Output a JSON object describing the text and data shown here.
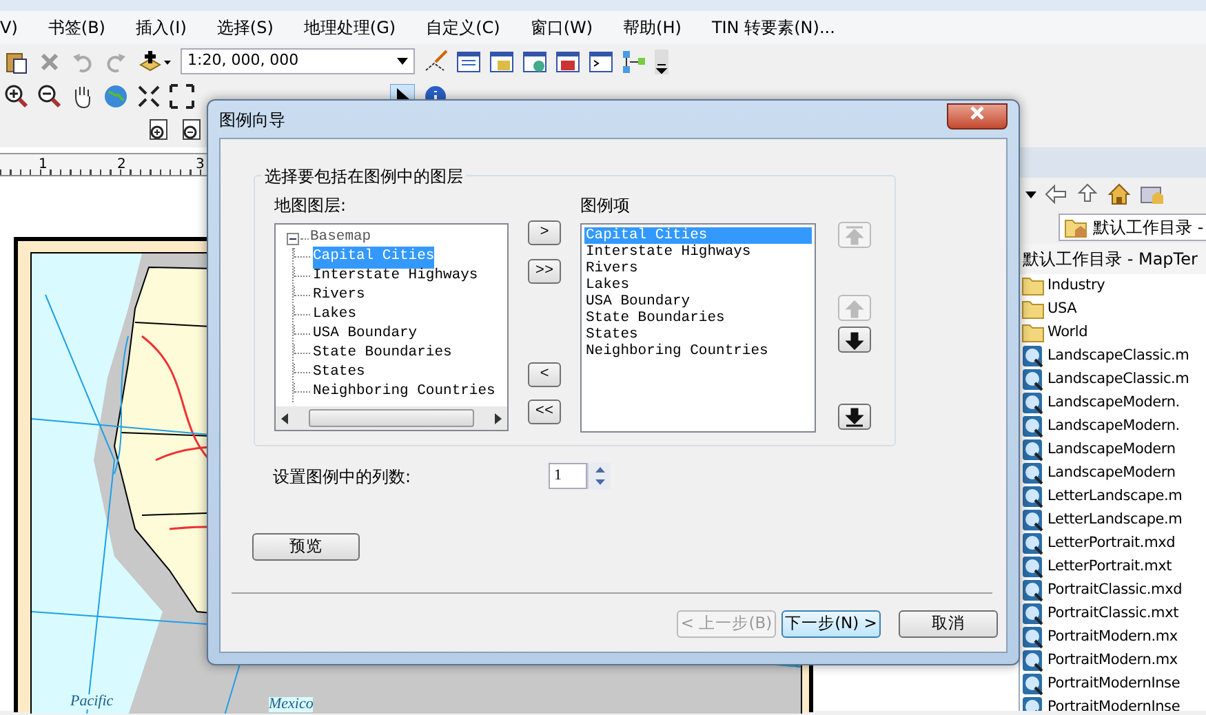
{
  "menu": [
    "V)",
    "书签(B)",
    "插入(I)",
    "选择(S)",
    "地理处理(G)",
    "自定义(C)",
    "窗口(W)",
    "帮助(H)",
    "TIN 转要素(N)..."
  ],
  "scale": "1:20, 000, 000",
  "ruler": [
    "1",
    "2",
    "3"
  ],
  "map": {
    "labels": [
      "Pacific",
      "Mexico"
    ]
  },
  "catalog": {
    "location": "默认工作目录 -",
    "header": "默认工作目录 - MapTer",
    "items": [
      {
        "kind": "folder",
        "name": "Industry"
      },
      {
        "kind": "folder",
        "name": "USA"
      },
      {
        "kind": "folder",
        "name": "World"
      },
      {
        "kind": "map",
        "name": "LandscapeClassic.m"
      },
      {
        "kind": "map",
        "name": "LandscapeClassic.m"
      },
      {
        "kind": "map",
        "name": "LandscapeModern."
      },
      {
        "kind": "map",
        "name": "LandscapeModern."
      },
      {
        "kind": "map",
        "name": "LandscapeModern"
      },
      {
        "kind": "map",
        "name": "LandscapeModern"
      },
      {
        "kind": "map",
        "name": "LetterLandscape.m"
      },
      {
        "kind": "map",
        "name": "LetterLandscape.m"
      },
      {
        "kind": "map",
        "name": "LetterPortrait.mxd"
      },
      {
        "kind": "map",
        "name": "LetterPortrait.mxt"
      },
      {
        "kind": "map",
        "name": "PortraitClassic.mxd"
      },
      {
        "kind": "map",
        "name": "PortraitClassic.mxt"
      },
      {
        "kind": "map",
        "name": "PortraitModern.mx"
      },
      {
        "kind": "map",
        "name": "PortraitModern.mx"
      },
      {
        "kind": "map",
        "name": "PortraitModernInse"
      },
      {
        "kind": "map",
        "name": "PortraitModernInse"
      }
    ]
  },
  "dialog": {
    "title": "图例向导",
    "group_title": "选择要包括在图例中的图层",
    "map_layers_label": "地图图层:",
    "tree": {
      "label": "Basemap",
      "expanded": true,
      "children": [
        {
          "label": "Capital Cities",
          "selected": true
        },
        {
          "label": "Interstate Highways",
          "selected": false
        },
        {
          "label": "Rivers",
          "selected": false
        },
        {
          "label": "Lakes",
          "selected": false
        },
        {
          "label": "USA Boundary",
          "selected": false
        },
        {
          "label": "State Boundaries",
          "selected": false
        },
        {
          "label": "States",
          "selected": false
        },
        {
          "label": "Neighboring Countries",
          "selected": false
        }
      ]
    },
    "transfer_buttons": [
      ">",
      ">>",
      "<",
      "<<"
    ],
    "legend_label": "图例项",
    "legend_items": [
      {
        "label": "Capital Cities",
        "selected": true
      },
      {
        "label": "Interstate Highways",
        "selected": false
      },
      {
        "label": "Rivers",
        "selected": false
      },
      {
        "label": "Lakes",
        "selected": false
      },
      {
        "label": "USA Boundary",
        "selected": false
      },
      {
        "label": "State Boundaries",
        "selected": false
      },
      {
        "label": "States",
        "selected": false
      },
      {
        "label": "Neighboring Countries",
        "selected": false
      }
    ],
    "move_buttons": [
      {
        "kind": "top",
        "disabled": true
      },
      {
        "kind": "up",
        "disabled": true
      },
      {
        "kind": "down",
        "disabled": false
      },
      {
        "kind": "bottom",
        "disabled": false
      }
    ],
    "columns_label": "设置图例中的列数:",
    "columns": "1",
    "preview": "预览",
    "back": {
      "label": "< 上一步(B)",
      "disabled": true
    },
    "next": "下一步(N) >",
    "cancel": "取消"
  }
}
